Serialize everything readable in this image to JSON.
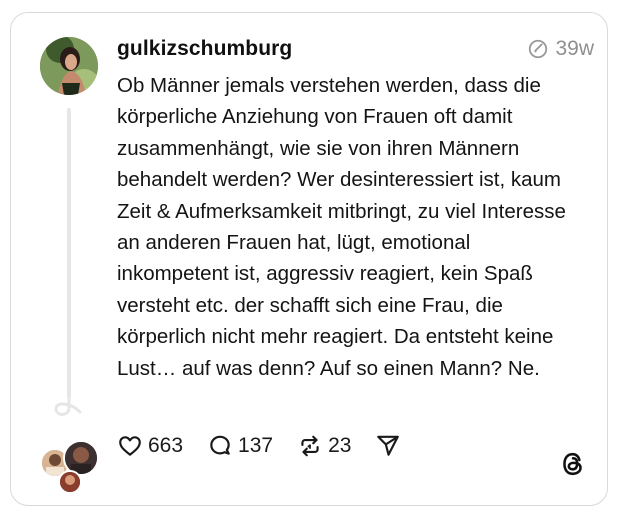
{
  "post": {
    "username": "gulkizschumburg",
    "time": "39w",
    "text": "Ob Männer jemals verstehen werden, dass die körperliche Anziehung von Frauen oft damit zusammenhängt, wie sie von ihren Männern behandelt werden? Wer desinteressiert ist, kaum Zeit & Aufmerksamkeit mitbringt, zu viel Interesse an anderen Frauen hat, lügt, emotional inkompetent ist, aggressiv reagiert, kein Spaß versteht etc. der schafft sich eine Frau, die körperlich nicht mehr reagiert. Da entsteht keine Lust… auf was denn? Auf so einen Mann? Ne."
  },
  "actions": {
    "likes": "663",
    "replies": "137",
    "reposts": "23"
  },
  "icons": {
    "time": "edited-clock-icon",
    "like": "heart-icon",
    "reply": "comment-bubble-icon",
    "repost": "repost-arrows-icon",
    "share": "send-icon",
    "brand": "threads-logo"
  },
  "colors": {
    "text": "#101010",
    "muted": "#8f8f8f",
    "border": "#d9d9d9"
  }
}
